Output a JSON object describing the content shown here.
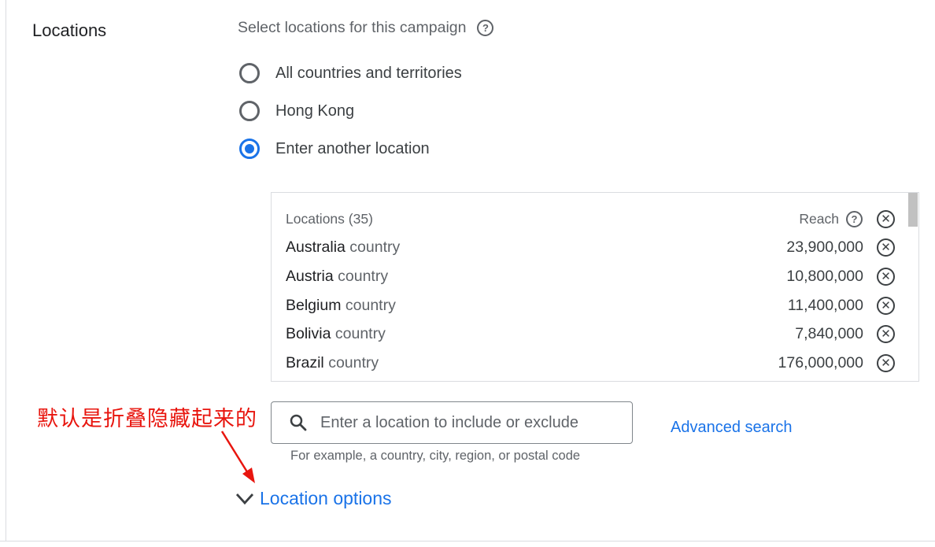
{
  "section_title": "Locations",
  "prompt": "Select locations for this campaign",
  "help_glyph": "?",
  "radio_options": [
    {
      "label": "All countries and territories",
      "selected": false
    },
    {
      "label": "Hong Kong",
      "selected": false
    },
    {
      "label": "Enter another location",
      "selected": true
    }
  ],
  "locations_list": {
    "header_label": "Locations (35)",
    "reach_label": "Reach",
    "remove_glyph": "✕",
    "rows": [
      {
        "name": "Australia",
        "type": "country",
        "reach": "23,900,000"
      },
      {
        "name": "Austria",
        "type": "country",
        "reach": "10,800,000"
      },
      {
        "name": "Belgium",
        "type": "country",
        "reach": "11,400,000"
      },
      {
        "name": "Bolivia",
        "type": "country",
        "reach": "7,840,000"
      },
      {
        "name": "Brazil",
        "type": "country",
        "reach": "176,000,000"
      }
    ]
  },
  "search": {
    "placeholder": "Enter a location to include or exclude",
    "hint": "For example, a country, city, region, or postal code"
  },
  "advanced_search_label": "Advanced search",
  "location_options_label": "Location options",
  "annotation_text": "默认是折叠隐藏起来的",
  "colors": {
    "accent": "#1a73e8",
    "annotation": "#e8150e",
    "text": "#3c4043",
    "muted": "#5f6368",
    "border": "#dadce0"
  },
  "icons": {
    "help": "question-circle-icon",
    "remove": "remove-circle-icon",
    "search": "search-icon",
    "expand": "chevron-down-icon"
  }
}
